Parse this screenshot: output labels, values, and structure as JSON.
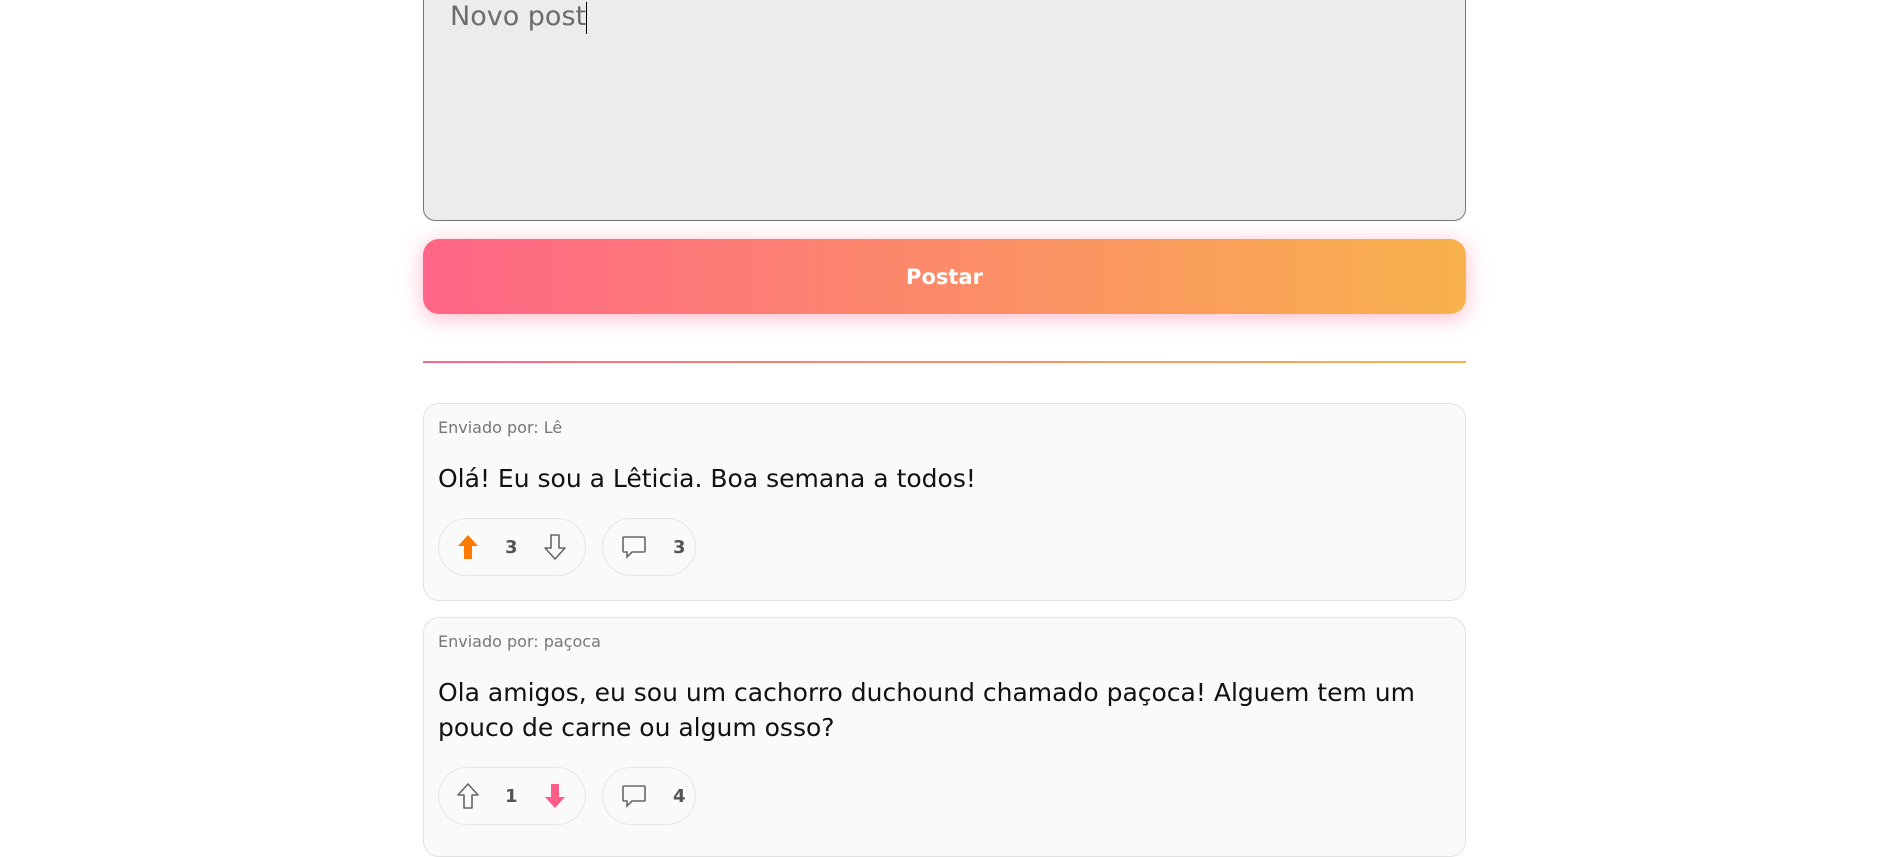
{
  "composer": {
    "placeholder": "Novo post",
    "submit_label": "Postar"
  },
  "posts": [
    {
      "author": "Enviado por: Lê",
      "text": "Olá! Eu sou a Lêticia. Boa semana a todos!",
      "votes": "3",
      "vote_state": "up",
      "comments": "3"
    },
    {
      "author": "Enviado por: paçoca",
      "text": "Ola amigos, eu sou um cachorro duchound chamado paçoca! Alguem tem um pouco de carne ou algum osso?",
      "votes": "1",
      "vote_state": "down",
      "comments": "4"
    }
  ],
  "colors": {
    "upvote": "#ff7a00",
    "downvote": "#ff5c87",
    "gradient_start": "#ff6587",
    "gradient_end": "#f8b24c"
  }
}
